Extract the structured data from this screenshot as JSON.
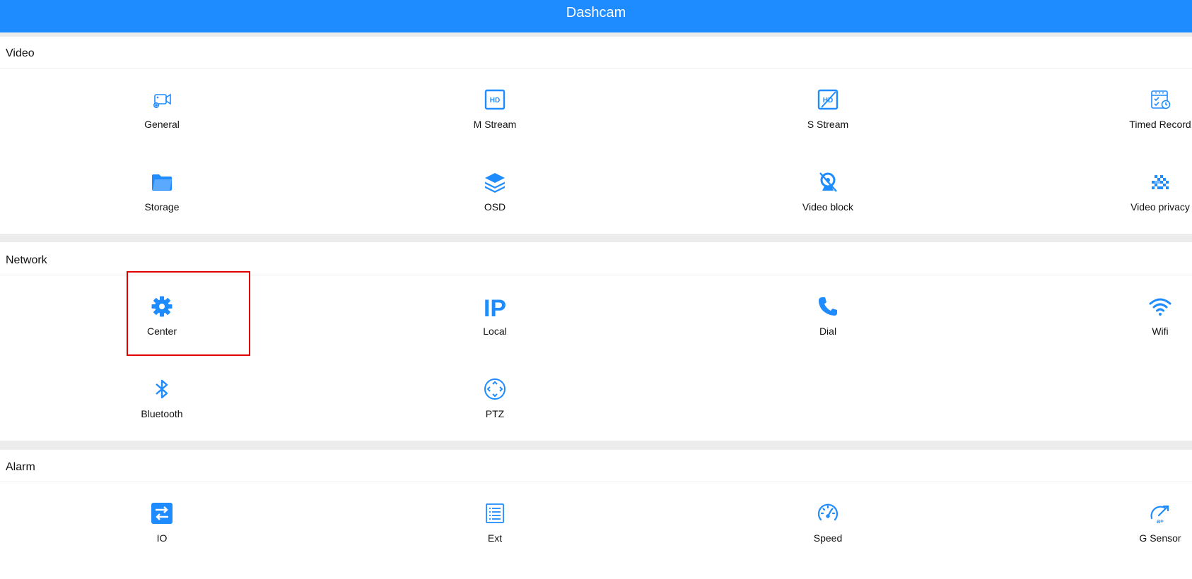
{
  "app": {
    "title": "Dashcam"
  },
  "colors": {
    "header": "#1e8bff",
    "icon": "#1e8bff",
    "highlight": "#e00000"
  },
  "sections": {
    "video": {
      "title": "Video",
      "items": [
        {
          "label": "General",
          "icon": "camera-settings-icon"
        },
        {
          "label": "M Stream",
          "icon": "hd-icon"
        },
        {
          "label": "S Stream",
          "icon": "hd-crossed-icon"
        },
        {
          "label": "Timed Record",
          "icon": "calendar-clock-icon"
        },
        {
          "label": "Storage",
          "icon": "folder-icon"
        },
        {
          "label": "OSD",
          "icon": "layers-icon"
        },
        {
          "label": "Video block",
          "icon": "camera-blocked-icon"
        },
        {
          "label": "Video privacy",
          "icon": "mosaic-icon"
        }
      ]
    },
    "network": {
      "title": "Network",
      "items": [
        {
          "label": "Center",
          "icon": "gear-icon"
        },
        {
          "label": "Local",
          "icon": "ip-icon"
        },
        {
          "label": "Dial",
          "icon": "phone-icon"
        },
        {
          "label": "Wifi",
          "icon": "wifi-icon"
        },
        {
          "label": "Bluetooth",
          "icon": "bluetooth-icon"
        },
        {
          "label": "PTZ",
          "icon": "ptz-icon"
        }
      ]
    },
    "alarm": {
      "title": "Alarm",
      "items": [
        {
          "label": "IO",
          "icon": "io-swap-icon"
        },
        {
          "label": "Ext",
          "icon": "document-list-icon"
        },
        {
          "label": "Speed",
          "icon": "speedometer-icon"
        },
        {
          "label": "G Sensor",
          "icon": "g-sensor-icon"
        }
      ]
    }
  }
}
